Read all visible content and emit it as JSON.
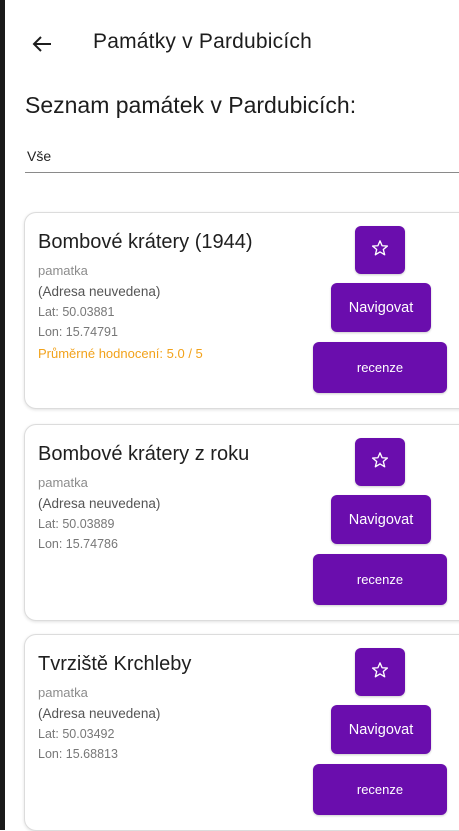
{
  "app_bar": {
    "title": "Památky v Pardubicích",
    "back_icon": "arrow-back-icon"
  },
  "page_heading": "Seznam památek v Pardubicích:",
  "filter": {
    "selected": "Vše"
  },
  "colors": {
    "button": "#6a0dad",
    "rating": "#f2a21b"
  },
  "monuments": [
    {
      "name": "Bombové krátery (1944)",
      "type": "pamatka",
      "address": "(Adresa neuvedena)",
      "lat": "Lat: 50.03881",
      "lon": "Lon: 15.74791",
      "rating": "Průměrné hodnocení: 5.0 / 5",
      "favorite_icon": "star-outline-icon",
      "navigate_label": "Navigovat",
      "reviews_label": "recenze"
    },
    {
      "name": "Bombové krátery z roku",
      "type": "pamatka",
      "address": "(Adresa neuvedena)",
      "lat": "Lat: 50.03889",
      "lon": "Lon: 15.74786",
      "favorite_icon": "star-outline-icon",
      "navigate_label": "Navigovat",
      "reviews_label": "recenze"
    },
    {
      "name": "Tvrziště Krchleby",
      "type": "pamatka",
      "address": "(Adresa neuvedena)",
      "lat": "Lat: 50.03492",
      "lon": "Lon: 15.68813",
      "favorite_icon": "star-outline-icon",
      "navigate_label": "Navigovat",
      "reviews_label": "recenze"
    }
  ]
}
